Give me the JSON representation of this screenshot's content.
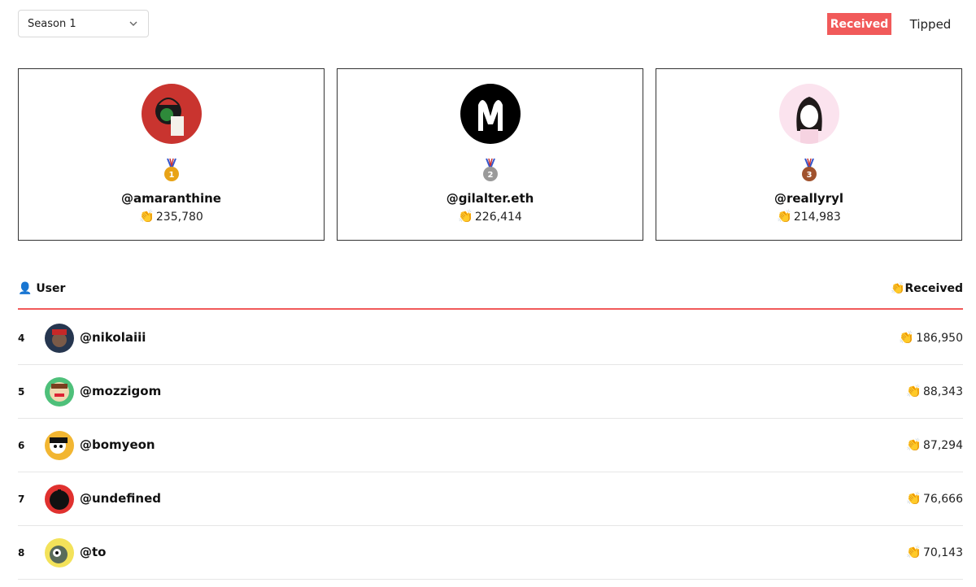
{
  "filter": {
    "season": "Season 1"
  },
  "toggle": {
    "received": "Received",
    "tipped": "Tipped"
  },
  "podium": [
    {
      "username": "@amaranthine",
      "score": "235,780",
      "medal": "1"
    },
    {
      "username": "@gilalter.eth",
      "score": "226,414",
      "medal": "2"
    },
    {
      "username": "@reallyryl",
      "score": "214,983",
      "medal": "3"
    }
  ],
  "table": {
    "header_user": "User",
    "header_received": "Received",
    "rows": [
      {
        "rank": "4",
        "username": "@nikolaiii",
        "score": "186,950"
      },
      {
        "rank": "5",
        "username": "@mozzigom",
        "score": "88,343"
      },
      {
        "rank": "6",
        "username": "@bomyeon",
        "score": "87,294"
      },
      {
        "rank": "7",
        "username": "@undefined",
        "score": "76,666"
      },
      {
        "rank": "8",
        "username": "@to",
        "score": "70,143"
      }
    ]
  },
  "icons": {
    "clap": "👏",
    "user": "👤"
  },
  "colors": {
    "accent": "#f15a5a",
    "gold": "#e8a317",
    "silver": "#9a9a9a",
    "bronze": "#a0522d"
  }
}
